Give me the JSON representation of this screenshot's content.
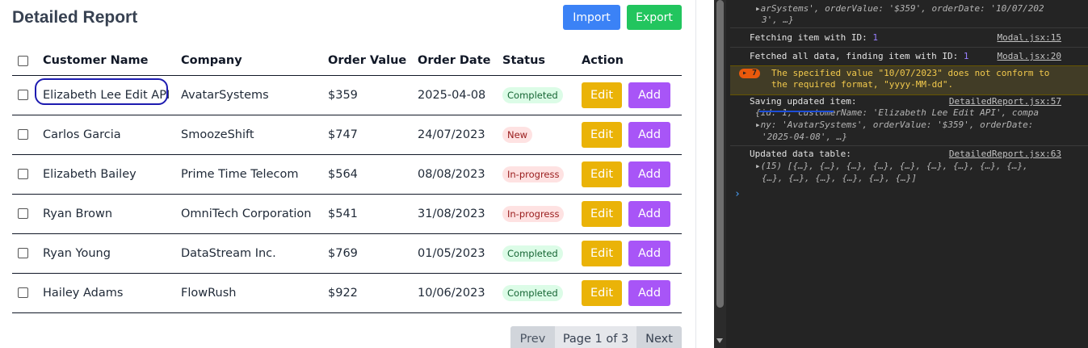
{
  "app": {
    "title": "Detailed Report",
    "import_label": "Import",
    "export_label": "Export",
    "columns": [
      "Customer Name",
      "Company",
      "Order Value",
      "Order Date",
      "Status",
      "Action"
    ],
    "rows": [
      {
        "name": "Elizabeth Lee Edit API",
        "company": "AvatarSystems",
        "value": "$359",
        "date": "2025-04-08",
        "status": "Completed"
      },
      {
        "name": "Carlos Garcia",
        "company": "SmoozeShift",
        "value": "$747",
        "date": "24/07/2023",
        "status": "New"
      },
      {
        "name": "Elizabeth Bailey",
        "company": "Prime Time Telecom",
        "value": "$564",
        "date": "08/08/2023",
        "status": "In-progress"
      },
      {
        "name": "Ryan Brown",
        "company": "OmniTech Corporation",
        "value": "$541",
        "date": "31/08/2023",
        "status": "In-progress"
      },
      {
        "name": "Ryan Young",
        "company": "DataStream Inc.",
        "value": "$769",
        "date": "01/05/2023",
        "status": "Completed"
      },
      {
        "name": "Hailey Adams",
        "company": "FlowRush",
        "value": "$922",
        "date": "10/06/2023",
        "status": "Completed"
      }
    ],
    "edit_label": "Edit",
    "add_label": "Add",
    "pager": {
      "prev": "Prev",
      "info": "Page 1 of 3",
      "next": "Next"
    }
  },
  "console": {
    "top_line1_a": "arSystems', orderValue: '$359', orderDate: '10/07/202",
    "top_line2": "3', …}",
    "fetching_text": "Fetching item with ID: ",
    "fetching_id": "1",
    "fetching_src": "Modal.jsx:15",
    "fetched_text": "Fetched all data, finding item with ID: ",
    "fetched_id": "1",
    "fetched_src": "Modal.jsx:20",
    "warn_count": "7",
    "warn_line1": "The specified value \"10/07/2023\" does not conform to",
    "warn_line2": "the required format, \"yyyy-MM-dd\".",
    "saving_text": "Saving updated item:",
    "saving_src": "DetailedReport.jsx:57",
    "saving_obj1": "{id: 1, customerName: 'Elizabeth Lee Edit API', compa",
    "saving_obj2": "ny: 'AvatarSystems', orderValue: '$359', orderDate:",
    "saving_obj3": "'2025-04-08', …}",
    "updated_text": "Updated data table:",
    "updated_src": "DetailedReport.jsx:63",
    "updated_arr1": "(15) [{…}, {…}, {…}, {…}, {…}, {…}, {…}, {…}, {…},",
    "updated_arr2": "{…}, {…}, {…}, {…}, {…}, {…}]",
    "prompt": "›"
  }
}
